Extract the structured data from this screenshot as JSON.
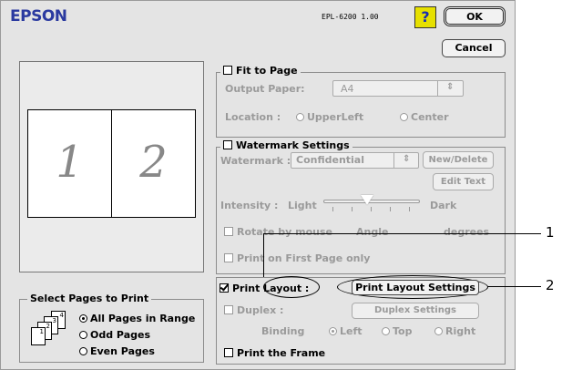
{
  "header": {
    "brand": "EPSON",
    "model": "EPL-6200  1.00",
    "help_label": "?",
    "ok_label": "OK",
    "cancel_label": "Cancel"
  },
  "preview": {
    "pages": [
      "1",
      "2"
    ]
  },
  "fit_to_page": {
    "title": "Fit to Page",
    "checked": false,
    "output_paper_label": "Output Paper:",
    "output_paper_value": "A4",
    "popup_arrows": "⇕",
    "location_label": "Location :",
    "location_options": [
      "UpperLeft",
      "Center"
    ]
  },
  "watermark": {
    "title": "Watermark Settings",
    "checked": false,
    "watermark_label": "Watermark :",
    "watermark_value": "Confidential",
    "popup_arrows": "⇕",
    "new_delete_label": "New/Delete",
    "edit_text_label": "Edit Text",
    "intensity_label": "Intensity :",
    "light_label": "Light",
    "dark_label": "Dark",
    "intensity_level": 0.45,
    "rotate_label": "Rotate by mouse",
    "angle_label": "Angle",
    "degrees_label": "degrees",
    "first_page_label": "Print on First Page only"
  },
  "select_pages": {
    "title": "Select Pages to Print",
    "icon_pages": [
      "1",
      "2",
      "3",
      "4"
    ],
    "options": [
      "All Pages in Range",
      "Odd Pages",
      "Even Pages"
    ],
    "selected": 0
  },
  "print_layout": {
    "checkbox_label": "Print Layout :",
    "checked": true,
    "settings_button_label": "Print Layout Settings",
    "duplex_label": "Duplex :",
    "duplex_checked": false,
    "duplex_settings_label": "Duplex Settings",
    "binding_label": "Binding",
    "binding_options": [
      "Left",
      "Top",
      "Right"
    ],
    "binding_selected": 0,
    "frame_label": "Print the Frame",
    "frame_checked": false
  },
  "callouts": [
    "1",
    "2"
  ]
}
